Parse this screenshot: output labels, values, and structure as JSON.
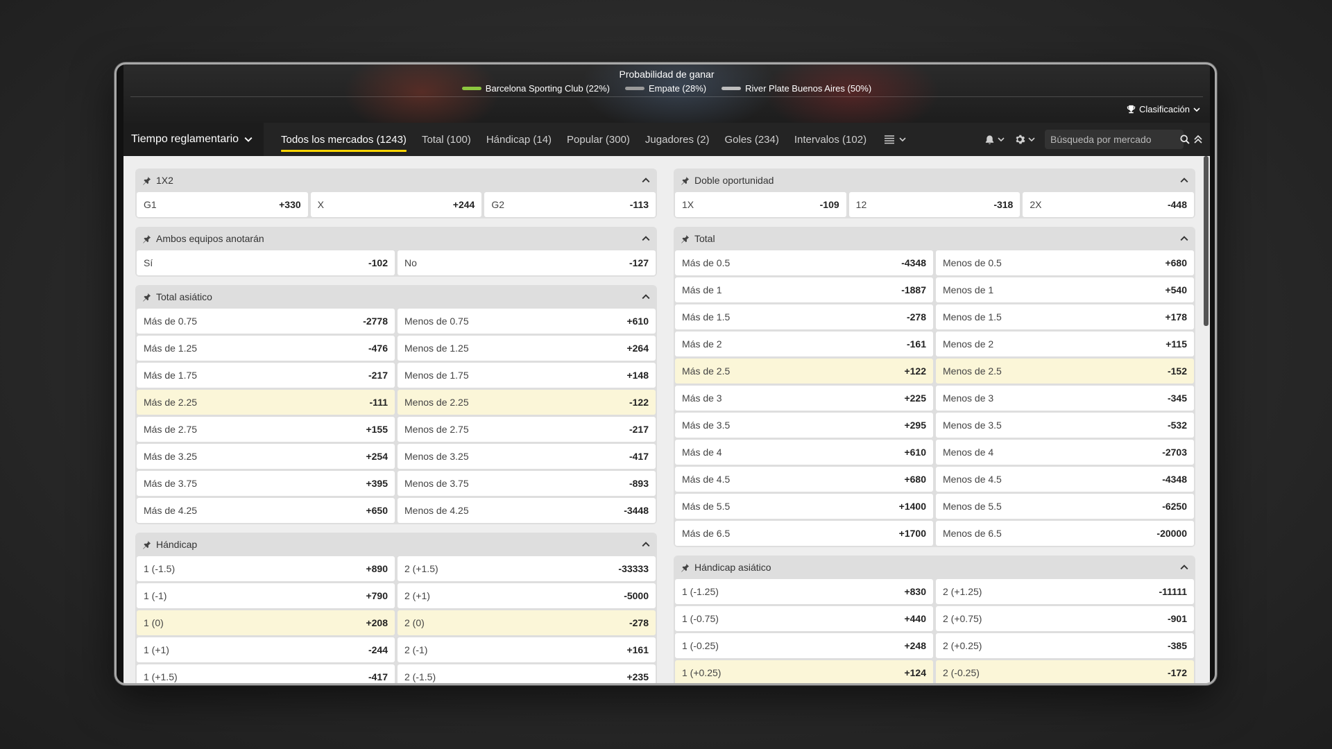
{
  "banner": {
    "title": "Probabilidad de ganar",
    "outcomes": [
      {
        "label": "Barcelona Sporting Club (22%)",
        "color": "#8dc63f"
      },
      {
        "label": "Empate (28%)",
        "color": "#9a9a9a"
      },
      {
        "label": "River Plate Buenos Aires (50%)",
        "color": "#bdbdbd"
      }
    ],
    "standings": "Clasificación"
  },
  "nav": {
    "period": "Tiempo reglamentario",
    "tabs": [
      {
        "label": "Todos los mercados (1243)",
        "active": true
      },
      {
        "label": "Total (100)"
      },
      {
        "label": "Hándicap (14)"
      },
      {
        "label": "Popular (300)"
      },
      {
        "label": "Jugadores (2)"
      },
      {
        "label": "Goles (234)"
      },
      {
        "label": "Intervalos (102)"
      }
    ],
    "search_placeholder": "Búsqueda por mercado",
    "accent": "#ffd400"
  },
  "left": [
    {
      "title": "1X2",
      "rows": [
        [
          [
            "G1",
            "+330"
          ],
          [
            "X",
            "+244"
          ],
          [
            "G2",
            "-113"
          ]
        ]
      ]
    },
    {
      "title": "Ambos equipos anotarán",
      "rows": [
        [
          [
            "Sí",
            "-102"
          ],
          [
            "No",
            "-127"
          ]
        ]
      ]
    },
    {
      "title": "Total asiático",
      "rows": [
        [
          [
            "Más de 0.75",
            "-2778"
          ],
          [
            "Menos de 0.75",
            "+610"
          ]
        ],
        [
          [
            "Más de 1.25",
            "-476"
          ],
          [
            "Menos de 1.25",
            "+264"
          ]
        ],
        [
          [
            "Más de 1.75",
            "-217"
          ],
          [
            "Menos de 1.75",
            "+148"
          ]
        ],
        [
          [
            "Más de 2.25",
            "-111"
          ],
          [
            "Menos de 2.25",
            "-122"
          ],
          "hl"
        ],
        [
          [
            "Más de 2.75",
            "+155"
          ],
          [
            "Menos de 2.75",
            "-217"
          ]
        ],
        [
          [
            "Más de 3.25",
            "+254"
          ],
          [
            "Menos de 3.25",
            "-417"
          ]
        ],
        [
          [
            "Más de 3.75",
            "+395"
          ],
          [
            "Menos de 3.75",
            "-893"
          ]
        ],
        [
          [
            "Más de 4.25",
            "+650"
          ],
          [
            "Menos de 4.25",
            "-3448"
          ]
        ]
      ]
    },
    {
      "title": "Hándicap",
      "rows": [
        [
          [
            "1 (-1.5)",
            "+890"
          ],
          [
            "2 (+1.5)",
            "-33333"
          ]
        ],
        [
          [
            "1 (-1)",
            "+790"
          ],
          [
            "2 (+1)",
            "-5000"
          ]
        ],
        [
          [
            "1 (0)",
            "+208"
          ],
          [
            "2 (0)",
            "-278"
          ],
          "hl"
        ],
        [
          [
            "1 (+1)",
            "-244"
          ],
          [
            "2 (-1)",
            "+161"
          ]
        ],
        [
          [
            "1 (+1.5)",
            "-417"
          ],
          [
            "2 (-1.5)",
            "+235"
          ]
        ]
      ]
    }
  ],
  "right": [
    {
      "title": "Doble oportunidad",
      "rows": [
        [
          [
            "1X",
            "-109"
          ],
          [
            "12",
            "-318"
          ],
          [
            "2X",
            "-448"
          ]
        ]
      ]
    },
    {
      "title": "Total",
      "rows": [
        [
          [
            "Más de 0.5",
            "-4348"
          ],
          [
            "Menos de 0.5",
            "+680"
          ]
        ],
        [
          [
            "Más de 1",
            "-1887"
          ],
          [
            "Menos de 1",
            "+540"
          ]
        ],
        [
          [
            "Más de 1.5",
            "-278"
          ],
          [
            "Menos de 1.5",
            "+178"
          ]
        ],
        [
          [
            "Más de 2",
            "-161"
          ],
          [
            "Menos de 2",
            "+115"
          ]
        ],
        [
          [
            "Más de 2.5",
            "+122"
          ],
          [
            "Menos de 2.5",
            "-152"
          ],
          "hl"
        ],
        [
          [
            "Más de 3",
            "+225"
          ],
          [
            "Menos de 3",
            "-345"
          ]
        ],
        [
          [
            "Más de 3.5",
            "+295"
          ],
          [
            "Menos de 3.5",
            "-532"
          ]
        ],
        [
          [
            "Más de 4",
            "+610"
          ],
          [
            "Menos de 4",
            "-2703"
          ]
        ],
        [
          [
            "Más de 4.5",
            "+680"
          ],
          [
            "Menos de 4.5",
            "-4348"
          ]
        ],
        [
          [
            "Más de 5.5",
            "+1400"
          ],
          [
            "Menos de 5.5",
            "-6250"
          ]
        ],
        [
          [
            "Más de 6.5",
            "+1700"
          ],
          [
            "Menos de 6.5",
            "-20000"
          ]
        ]
      ]
    },
    {
      "title": "Hándicap asiático",
      "rows": [
        [
          [
            "1 (-1.25)",
            "+830"
          ],
          [
            "2 (+1.25)",
            "-11111"
          ]
        ],
        [
          [
            "1 (-0.75)",
            "+440"
          ],
          [
            "2 (+0.75)",
            "-901"
          ]
        ],
        [
          [
            "1 (-0.25)",
            "+248"
          ],
          [
            "2 (+0.25)",
            "-385"
          ]
        ],
        [
          [
            "1 (+0.25)",
            "+124"
          ],
          [
            "2 (-0.25)",
            "-172"
          ],
          "hl"
        ]
      ]
    }
  ]
}
